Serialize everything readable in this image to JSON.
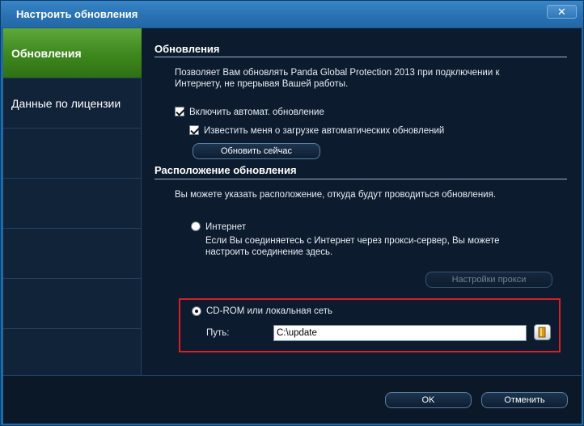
{
  "window": {
    "title": "Настроить обновления",
    "close_glyph": "✕"
  },
  "sidebar": {
    "items": [
      {
        "label": "Обновления",
        "active": true
      },
      {
        "label": "Данные по лицензии",
        "active": false
      }
    ]
  },
  "updates": {
    "section_title": "Обновления",
    "description": "Позволяет Вам обновлять Panda Global Protection 2013 при подключении к Интернету, не прерывая Вашей работы.",
    "auto_update_label": "Включить автомат. обновление",
    "auto_update_checked": true,
    "notify_label": "Известить меня о загрузке автоматических обновлений",
    "notify_checked": true,
    "update_now_button": "Обновить сейчас"
  },
  "location": {
    "section_title": "Расположение обновления",
    "description": "Вы можете указать расположение, откуда будут проводиться обновления.",
    "internet_label": "Интернет",
    "internet_selected": false,
    "internet_description": "Если Вы соединяетесь с Интернет через прокси-сервер, Вы можете настроить соединение здесь.",
    "proxy_button": "Настройки прокси",
    "cdrom_label": "CD-ROM или локальная сеть",
    "cdrom_selected": true,
    "path_label": "Путь:",
    "path_value": "C:\\update",
    "browse_icon": "folder-icon"
  },
  "footer": {
    "ok_button": "OK",
    "cancel_button": "Отменить"
  },
  "colors": {
    "accent_green": "#3f8a1f",
    "titlebar_blue": "#2a73b4",
    "highlight_red": "#d81e26"
  }
}
